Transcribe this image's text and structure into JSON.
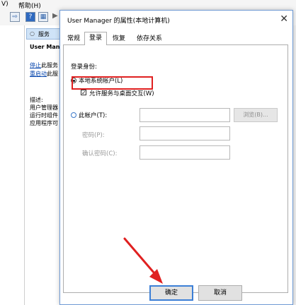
{
  "menubar": {
    "items": [
      "V)",
      "帮助(H)"
    ]
  },
  "background": {
    "tab_label": "服务",
    "selected_name": "User Man",
    "stop_link": "停止",
    "stop_suffix": "此服务",
    "restart_link": "重启动",
    "restart_suffix": "此服",
    "desc_label": "描述:",
    "desc_lines": [
      "用户管理器",
      "运行时组件",
      "应用程序可"
    ]
  },
  "dialog": {
    "title": "User Manager 的属性(本地计算机)",
    "close_glyph": "✕",
    "tabs": [
      "常规",
      "登录",
      "恢复",
      "依存关系"
    ],
    "active_tab": "登录",
    "logon_as_label": "登录身份:",
    "local_system_label": "本地系统帐户(L)",
    "allow_desktop_label": "允许服务与桌面交互(W)",
    "allow_desktop_checked": true,
    "this_account_label": "此帐户(T):",
    "browse_label": "浏览(B)...",
    "password_label": "密码(P):",
    "confirm_password_label": "确认密码(C):",
    "ok_label": "确定",
    "cancel_label": "取消"
  },
  "colors": {
    "highlight_box": "#e02020",
    "arrow": "#e02020",
    "accent": "#3c7fd6"
  }
}
